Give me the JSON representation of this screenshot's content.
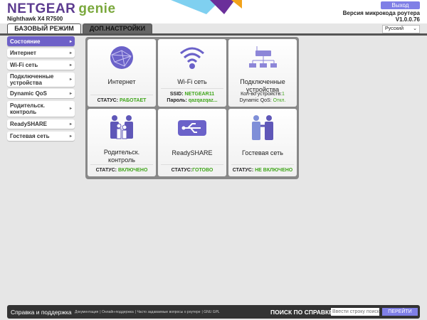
{
  "header": {
    "brand": "NETGEAR",
    "brand2": "genie",
    "model": "Nighthawk X4 R7500",
    "logout": "Выход",
    "fw_label": "Версия микрокода роутера",
    "fw_version": "V1.0.0.76",
    "language": "Русский"
  },
  "tabs": [
    "БАЗОВЫЙ РЕЖИМ",
    "ДОП.НАСТРОЙКИ"
  ],
  "sidebar": [
    "Состояние",
    "Интернет",
    "Wi-Fi сеть",
    "Подключенные устройства",
    "Dynamic QoS",
    "Родительск. контроль",
    "ReadySHARE",
    "Гостевая сеть"
  ],
  "tiles": {
    "internet": {
      "title": "Интернет",
      "label": "СТАТУС: ",
      "value": "РАБОТАЕТ"
    },
    "wifi": {
      "title": "Wi-Fi сеть",
      "ssid_label": "SSID: ",
      "ssid": "NETGEAR11",
      "pw_label": "Пароль: ",
      "pw": "qazqazqaz..."
    },
    "devices": {
      "title": "Подключенные устройства",
      "count_label": "Кол-во устройств:",
      "count": "1",
      "qos_label": "Dynamic QoS: ",
      "qos": "Откл."
    },
    "parental": {
      "title": "Родительск. контроль",
      "label": "СТАТУС: ",
      "value": "ВКЛЮЧЕНО"
    },
    "readyshare": {
      "title": "ReadySHARE",
      "label": "СТАТУС:",
      "value": "ГОТОВО"
    },
    "guest": {
      "title": "Гостевая сеть",
      "label": "СТАТУС: ",
      "value": "НЕ ВКЛЮЧЕНО"
    }
  },
  "footer": {
    "title": "Справка и поддержка",
    "links": [
      "Документация",
      "Онлайн-поддержка",
      "Часто задаваемые вопросы о роутере",
      "GNU GPL"
    ],
    "search_label": "ПОИСК ПО СПРАВКЕ",
    "search_placeholder": "Ввести строку поиск",
    "go": "ПЕРЕЙТИ"
  }
}
